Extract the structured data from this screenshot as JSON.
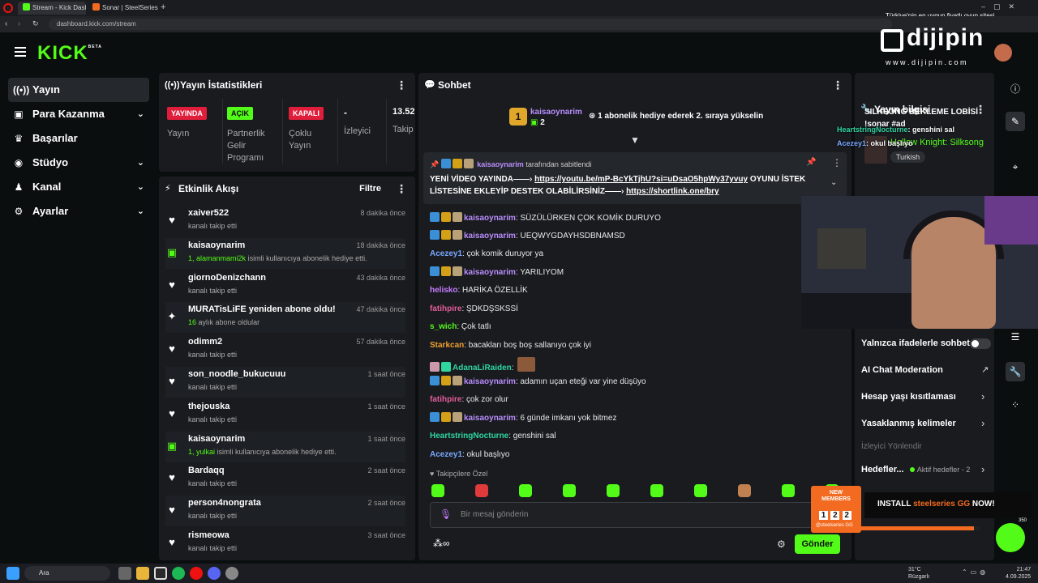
{
  "browser": {
    "tabs": [
      {
        "label": "Stream - Kick Dashboard"
      },
      {
        "label": "Sonar | SteelSeries"
      }
    ],
    "url": "dashboard.kick.com/stream"
  },
  "overlay": {
    "promo_text": "Türkiye'nin en uygun fiyatlı oyun sitesi",
    "brand": "dijipin",
    "brand_url": "w w w . d i j i p i n . c o m"
  },
  "header": {
    "logo": "KICK",
    "logo_sup": "BETA"
  },
  "sidebar": {
    "items": [
      {
        "label": "Yayın",
        "icon": "live-icon"
      },
      {
        "label": "Para Kazanma",
        "icon": "money-icon"
      },
      {
        "label": "Başarılar",
        "icon": "trophy-icon"
      },
      {
        "label": "Stüdyo",
        "icon": "studio-icon"
      },
      {
        "label": "Kanal",
        "icon": "channel-icon"
      },
      {
        "label": "Ayarlar",
        "icon": "settings-icon"
      }
    ]
  },
  "stats": {
    "title": "Yayın İstatistikleri",
    "items": [
      {
        "badge": "YAYINDA",
        "label": "Yayın",
        "color": "#e01e3c"
      },
      {
        "badge": "AÇIK",
        "label": "Partnerlik Gelir Programı",
        "color": "#53fc18"
      },
      {
        "badge": "KAPALI",
        "label": "Çoklu Yayın",
        "color": "#e01e3c"
      },
      {
        "value": "-",
        "label": "İzleyici"
      },
      {
        "value": "13.52",
        "label": "Takip"
      }
    ]
  },
  "activity": {
    "title": "Etkinlik Akışı",
    "filter": "Filtre",
    "items": [
      {
        "name": "xaiver522",
        "sub": "kanalı takip etti",
        "time": "8 dakika önce",
        "type": "follow"
      },
      {
        "name": "kaisaoynarim",
        "sub_num": "1,",
        "sub_user": "alamanmami2k",
        "sub": "isimli kullanıcıya abonelik hediye etti.",
        "time": "18 dakika önce",
        "type": "gift"
      },
      {
        "name": "giornoDenizchann",
        "sub": "kanalı takip etti",
        "time": "43 dakika önce",
        "type": "follow"
      },
      {
        "name": "MURATisLiFE yeniden abone oldu!",
        "sub_num": "16",
        "sub": "aylık abone oldular",
        "time": "47 dakika önce",
        "type": "resub"
      },
      {
        "name": "odimm2",
        "sub": "kanalı takip etti",
        "time": "57 dakika önce",
        "type": "follow"
      },
      {
        "name": "son_noodle_bukucuuu",
        "sub": "kanalı takip etti",
        "time": "1 saat önce",
        "type": "follow"
      },
      {
        "name": "thejouska",
        "sub": "kanalı takip etti",
        "time": "1 saat önce",
        "type": "follow"
      },
      {
        "name": "kaisaoynarim",
        "sub_num": "1,",
        "sub_user": "yulkai",
        "sub": "isimli kullanıcıya abonelik hediye etti.",
        "time": "1 saat önce",
        "type": "gift"
      },
      {
        "name": "Bardaqq",
        "sub": "kanalı takip etti",
        "time": "2 saat önce",
        "type": "follow"
      },
      {
        "name": "person4nongrata",
        "sub": "kanalı takip etti",
        "time": "2 saat önce",
        "type": "follow"
      },
      {
        "name": "rismeowa",
        "sub": "kanalı takip etti",
        "time": "3 saat önce",
        "type": "follow"
      }
    ]
  },
  "chat": {
    "title": "Sohbet",
    "gifter": {
      "name": "kaisaoynarim",
      "count": "2",
      "rank": "1"
    },
    "gift_goal": "1 abonelik hediye ederek 2. sıraya yükselin",
    "pinned_by_user": "kaisaoynarim",
    "pinned_by": "tarafından sabitlendi",
    "pinned_text_1": "YENİ VİDEO YAYINDA——›",
    "pinned_link_1": "https://youtu.be/mP-BcYkTjhU?si=uDsaO5hpWy37yvuy",
    "pinned_text_2": "OYUNU",
    "pinned_text_3": "İSTEK LİSTESİNE EKLEYİP DESTEK OLABİLİRSİNİZ——›",
    "pinned_link_2": "https://shortlink.one/bry",
    "messages": [
      {
        "user": "kaisaoynarim",
        "text": ": SÜZÜLÜRKEN ÇOK KOMİK DURUYO",
        "color": "#b98dfc",
        "badges": true
      },
      {
        "user": "kaisaoynarim",
        "text": ": UEQWYGDAYHSDBNAMSD",
        "color": "#b98dfc",
        "badges": true
      },
      {
        "user": "Acezey1",
        "text": ": çok komik duruyor ya",
        "color": "#7aa7ff",
        "badges": false
      },
      {
        "user": "kaisaoynarim",
        "text": ": YARILIYOM",
        "color": "#b98dfc",
        "badges": true
      },
      {
        "user": "helisko",
        "text": ": HARİKA ÖZELLİK",
        "color": "#c77dff",
        "badges": false
      },
      {
        "user": "fatihpire",
        "text": ": ŞDKDŞSKSSİ",
        "color": "#e35d9a",
        "badges": false
      },
      {
        "user": "s_wich",
        "text": ": Çok tatlı",
        "color": "#53fc18",
        "badges": false
      },
      {
        "user": "Starkcan",
        "text": ": bacakları boş boş sallanıyo çok iyi",
        "color": "#f0a030",
        "badges": false
      },
      {
        "user": "AdanaLiRaiden",
        "text": ":",
        "color": "#2fd6a0",
        "badges": false
      },
      {
        "user": "kaisaoynarim",
        "text": ": adamın uçan eteği var yine düşüyo",
        "color": "#b98dfc",
        "badges": true
      },
      {
        "user": "fatihpire",
        "text": ": çok zor olur",
        "color": "#e35d9a",
        "badges": false
      },
      {
        "user": "kaisaoynarim",
        "text": ": 6 günde imkanı yok bitmez",
        "color": "#b98dfc",
        "badges": true
      },
      {
        "user": "HeartstringNocturne",
        "text": ": genshini sal",
        "color": "#2fd6a0",
        "badges": false
      },
      {
        "user": "Acezey1",
        "text": ": okul başlıyo",
        "color": "#7aa7ff",
        "badges": false
      }
    ],
    "followers_only": "Takipçilere Özel",
    "input_placeholder": "Bir mesaj gönderin",
    "send": "Gönder"
  },
  "stream_info": {
    "title": "Yayın bilgisi",
    "stream_title": "SILKSONG BEKLEME LOBİSİ",
    "stream_title_2": "!sonar #ad",
    "category": "Hollow Knight: Silksong",
    "language": "Turkish"
  },
  "overlay_chat": [
    {
      "user": "HeartstringNocturne",
      "text": ": genshini sal"
    },
    {
      "user": "Acezey1",
      "text": ": okul başlıyo"
    }
  ],
  "settings": {
    "emote_only": "Yalnızca ifadelerle sohbet",
    "ai_mod": "AI Chat Moderation",
    "age_limit": "Hesap yaşı kısıtlaması",
    "banned_words": "Yasaklanmış kelimeler",
    "viewer_guide": "İzleyici Yönlendir",
    "goals": "Hedefler...",
    "goals_active": "Aktif hedefler - 2"
  },
  "ad": {
    "new_members": "NEW MEMBERS",
    "counter": [
      "1",
      "2",
      "2"
    ],
    "install": "INSTALL",
    "brand": "steelseries GG",
    "now": "NOW!",
    "small": "@steelseries GG",
    "progress": 0.95,
    "right_num": "350"
  },
  "taskbar": {
    "search": "Ara",
    "weather": "31°C",
    "weather_sub": "Rüzgarlı",
    "time": "21:47",
    "date": "4.09.2025"
  }
}
